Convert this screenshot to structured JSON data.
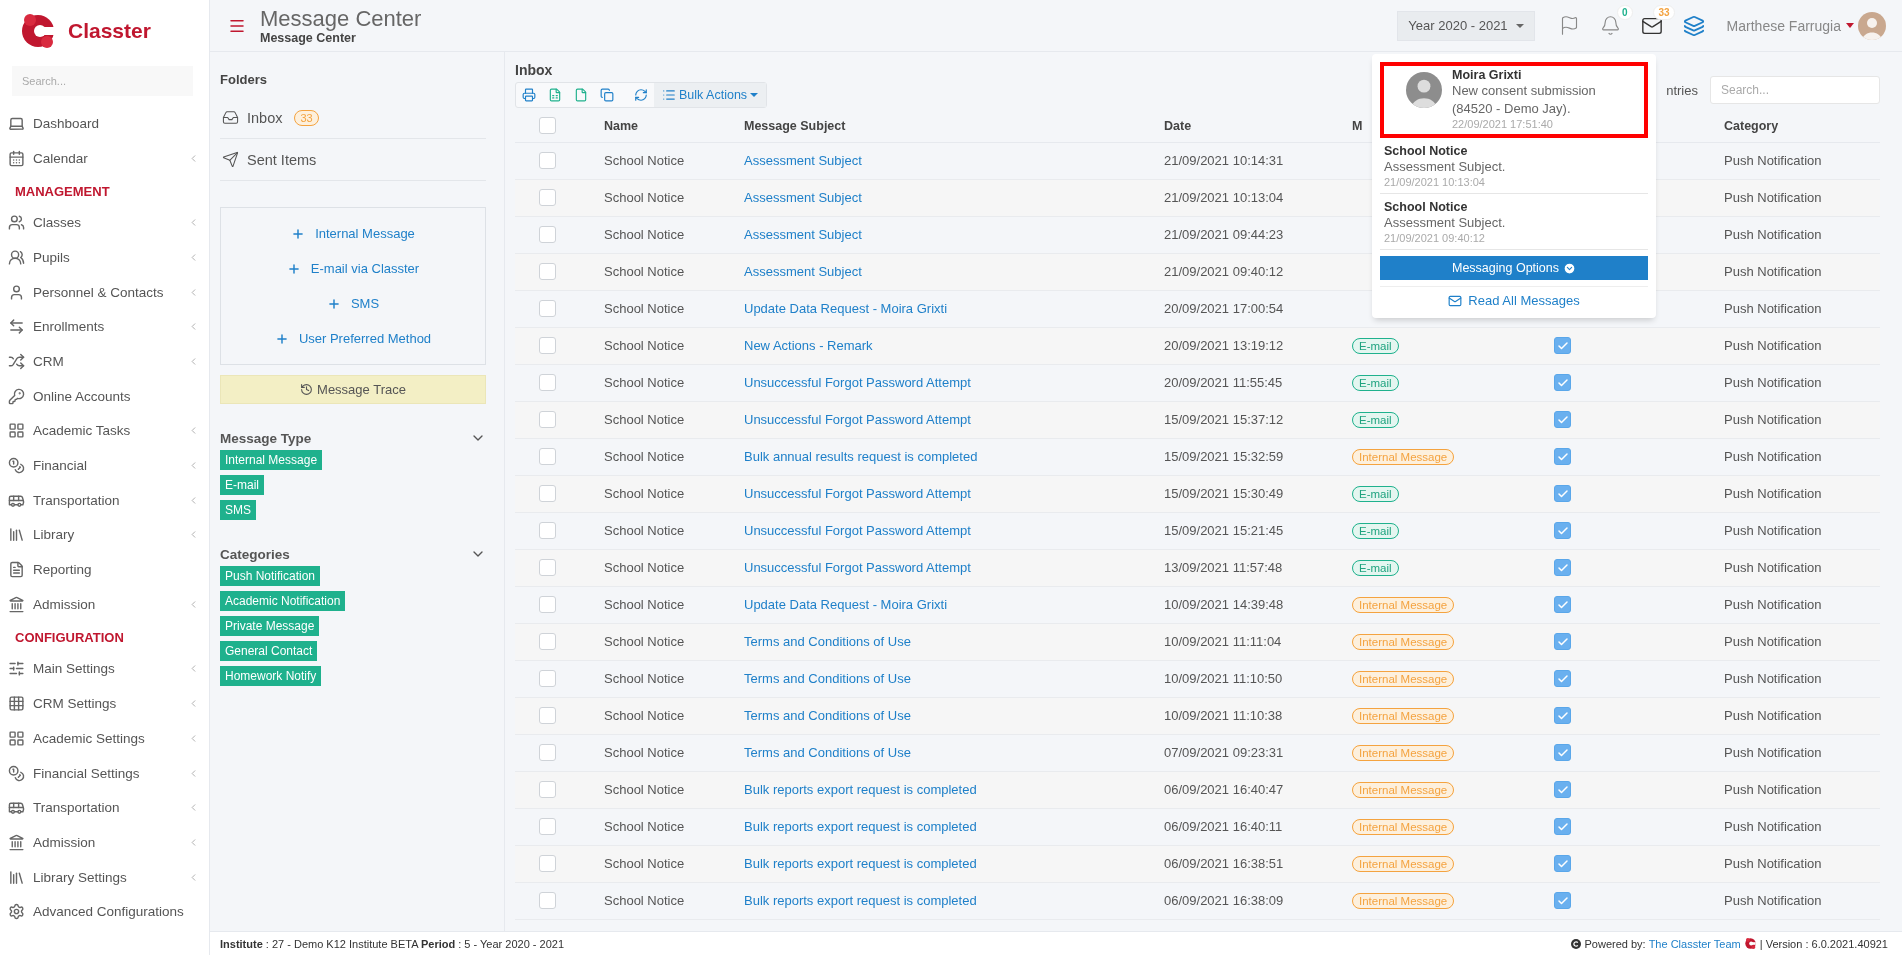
{
  "brand": {
    "name": "Classter"
  },
  "sidebar": {
    "search_placeholder": "Search...",
    "sections": [
      {
        "items": [
          {
            "label": "Dashboard",
            "expandable": false
          },
          {
            "label": "Calendar",
            "expandable": true
          }
        ]
      },
      {
        "heading": "MANAGEMENT",
        "items": [
          {
            "label": "Classes",
            "expandable": true
          },
          {
            "label": "Pupils",
            "expandable": true
          },
          {
            "label": "Personnel & Contacts",
            "expandable": true
          },
          {
            "label": "Enrollments",
            "expandable": true
          },
          {
            "label": "CRM",
            "expandable": true
          },
          {
            "label": "Online Accounts",
            "expandable": false
          },
          {
            "label": "Academic Tasks",
            "expandable": true
          },
          {
            "label": "Financial",
            "expandable": true
          },
          {
            "label": "Transportation",
            "expandable": true
          },
          {
            "label": "Library",
            "expandable": true
          },
          {
            "label": "Reporting",
            "expandable": false
          },
          {
            "label": "Admission",
            "expandable": true
          }
        ]
      },
      {
        "heading": "CONFIGURATION",
        "items": [
          {
            "label": "Main Settings",
            "expandable": true
          },
          {
            "label": "CRM Settings",
            "expandable": true
          },
          {
            "label": "Academic Settings",
            "expandable": true
          },
          {
            "label": "Financial Settings",
            "expandable": true
          },
          {
            "label": "Transportation",
            "expandable": true
          },
          {
            "label": "Admission",
            "expandable": true
          },
          {
            "label": "Library Settings",
            "expandable": true
          },
          {
            "label": "Advanced Configurations",
            "expandable": false
          }
        ]
      }
    ]
  },
  "header": {
    "title": "Message Center",
    "breadcrumb": "Message Center",
    "year": "Year 2020 - 2021",
    "alerts_badge": "0",
    "messages_badge": "33",
    "user": "Marthese Farrugia"
  },
  "notifications": {
    "items": [
      {
        "kind": "with_avatar",
        "sender": "Moira Grixti",
        "message": "New consent submission (84520 - Demo Jay).",
        "time": "22/09/2021 17:51:40",
        "highlighted": true
      },
      {
        "kind": "plain",
        "sender": "School Notice",
        "message": "Assessment Subject.",
        "time": "21/09/2021 10:13:04",
        "highlighted": false
      },
      {
        "kind": "plain",
        "sender": "School Notice",
        "message": "Assessment Subject.",
        "time": "21/09/2021 09:40:12",
        "highlighted": false
      }
    ],
    "options_button": "Messaging Options",
    "read_all": "Read All Messages"
  },
  "folders": {
    "title": "Folders",
    "items": [
      {
        "label": "Inbox",
        "badge": "33"
      },
      {
        "label": "Sent Items"
      }
    ],
    "compose": [
      "Internal Message",
      "E-mail via Classter",
      "SMS",
      "User Preferred Method"
    ],
    "trace_button": "Message Trace",
    "filters": [
      {
        "title": "Message Type",
        "expanded": true,
        "tags": [
          "Internal Message",
          "E-mail",
          "SMS"
        ]
      },
      {
        "title": "Categories",
        "expanded": true,
        "tags": [
          "Push Notification",
          "Academic Notification",
          "Private Message",
          "General Contact",
          "Homework Notify"
        ]
      }
    ]
  },
  "inbox": {
    "title": "Inbox",
    "bulk_actions": "Bulk Actions",
    "entries_fragment": "ntries",
    "search_placeholder": "Search...",
    "select_all": false,
    "header": {
      "name": "Name",
      "subject": "Message Subject",
      "date": "Date",
      "column_4": "M",
      "category": "Category"
    },
    "rows": [
      {
        "selected": false,
        "name": "School Notice",
        "subject": "Assessment Subject",
        "date": "21/09/2021 10:14:31",
        "category": "Push Notification"
      },
      {
        "selected": false,
        "name": "School Notice",
        "subject": "Assessment Subject",
        "date": "21/09/2021 10:13:04",
        "category": "Push Notification"
      },
      {
        "selected": false,
        "name": "School Notice",
        "subject": "Assessment Subject",
        "date": "21/09/2021 09:44:23",
        "category": "Push Notification"
      },
      {
        "selected": false,
        "name": "School Notice",
        "subject": "Assessment Subject",
        "date": "21/09/2021 09:40:12",
        "category": "Push Notification"
      },
      {
        "selected": false,
        "name": "School Notice",
        "subject": "Update Data Request - Moira Grixti",
        "date": "20/09/2021 17:00:54",
        "category": "Push Notification"
      },
      {
        "selected": false,
        "name": "School Notice",
        "subject": "New Actions - Remark",
        "date": "20/09/2021 13:19:12",
        "type": {
          "kind": "email",
          "label": "E-mail"
        },
        "checked": true,
        "category": "Push Notification"
      },
      {
        "selected": false,
        "name": "School Notice",
        "subject": "Unsuccessful Forgot Password Attempt",
        "date": "20/09/2021 11:55:45",
        "type": {
          "kind": "email",
          "label": "E-mail"
        },
        "checked": true,
        "category": "Push Notification"
      },
      {
        "selected": false,
        "name": "School Notice",
        "subject": "Unsuccessful Forgot Password Attempt",
        "date": "15/09/2021 15:37:12",
        "type": {
          "kind": "email",
          "label": "E-mail"
        },
        "checked": true,
        "category": "Push Notification"
      },
      {
        "selected": false,
        "name": "School Notice",
        "subject": "Bulk annual results request is completed",
        "date": "15/09/2021 15:32:59",
        "type": {
          "kind": "internal",
          "label": "Internal Message"
        },
        "checked": true,
        "category": "Push Notification"
      },
      {
        "selected": false,
        "name": "School Notice",
        "subject": "Unsuccessful Forgot Password Attempt",
        "date": "15/09/2021 15:30:49",
        "type": {
          "kind": "email",
          "label": "E-mail"
        },
        "checked": true,
        "category": "Push Notification"
      },
      {
        "selected": false,
        "name": "School Notice",
        "subject": "Unsuccessful Forgot Password Attempt",
        "date": "15/09/2021 15:21:45",
        "type": {
          "kind": "email",
          "label": "E-mail"
        },
        "checked": true,
        "category": "Push Notification"
      },
      {
        "selected": false,
        "name": "School Notice",
        "subject": "Unsuccessful Forgot Password Attempt",
        "date": "13/09/2021 11:57:48",
        "type": {
          "kind": "email",
          "label": "E-mail"
        },
        "checked": true,
        "category": "Push Notification"
      },
      {
        "selected": false,
        "name": "School Notice",
        "subject": "Update Data Request - Moira Grixti",
        "date": "10/09/2021 14:39:48",
        "type": {
          "kind": "internal",
          "label": "Internal Message"
        },
        "checked": true,
        "category": "Push Notification"
      },
      {
        "selected": false,
        "name": "School Notice",
        "subject": "Terms and Conditions of Use",
        "date": "10/09/2021 11:11:04",
        "type": {
          "kind": "internal",
          "label": "Internal Message"
        },
        "checked": true,
        "category": "Push Notification"
      },
      {
        "selected": false,
        "name": "School Notice",
        "subject": "Terms and Conditions of Use",
        "date": "10/09/2021 11:10:50",
        "type": {
          "kind": "internal",
          "label": "Internal Message"
        },
        "checked": true,
        "category": "Push Notification"
      },
      {
        "selected": false,
        "name": "School Notice",
        "subject": "Terms and Conditions of Use",
        "date": "10/09/2021 11:10:38",
        "type": {
          "kind": "internal",
          "label": "Internal Message"
        },
        "checked": true,
        "category": "Push Notification"
      },
      {
        "selected": false,
        "name": "School Notice",
        "subject": "Terms and Conditions of Use",
        "date": "07/09/2021 09:23:31",
        "type": {
          "kind": "internal",
          "label": "Internal Message"
        },
        "checked": true,
        "category": "Push Notification"
      },
      {
        "selected": false,
        "name": "School Notice",
        "subject": "Bulk reports export request is completed",
        "date": "06/09/2021 16:40:47",
        "type": {
          "kind": "internal",
          "label": "Internal Message"
        },
        "checked": true,
        "category": "Push Notification"
      },
      {
        "selected": false,
        "name": "School Notice",
        "subject": "Bulk reports export request is completed",
        "date": "06/09/2021 16:40:11",
        "type": {
          "kind": "internal",
          "label": "Internal Message"
        },
        "checked": true,
        "category": "Push Notification"
      },
      {
        "selected": false,
        "name": "School Notice",
        "subject": "Bulk reports export request is completed",
        "date": "06/09/2021 16:38:51",
        "type": {
          "kind": "internal",
          "label": "Internal Message"
        },
        "checked": true,
        "category": "Push Notification"
      },
      {
        "selected": false,
        "name": "School Notice",
        "subject": "Bulk reports export request is completed",
        "date": "06/09/2021 16:38:09",
        "type": {
          "kind": "internal",
          "label": "Internal Message"
        },
        "checked": true,
        "category": "Push Notification"
      }
    ]
  },
  "footer": {
    "info": "**Institute** : 27 - Demo K12 Institute BETA **Period** : 5 - Year 2020 - 2021",
    "powered_by": "Powered by:",
    "team_link": "The Classter Team",
    "version": "| Version : 6.0.2021.40921"
  }
}
